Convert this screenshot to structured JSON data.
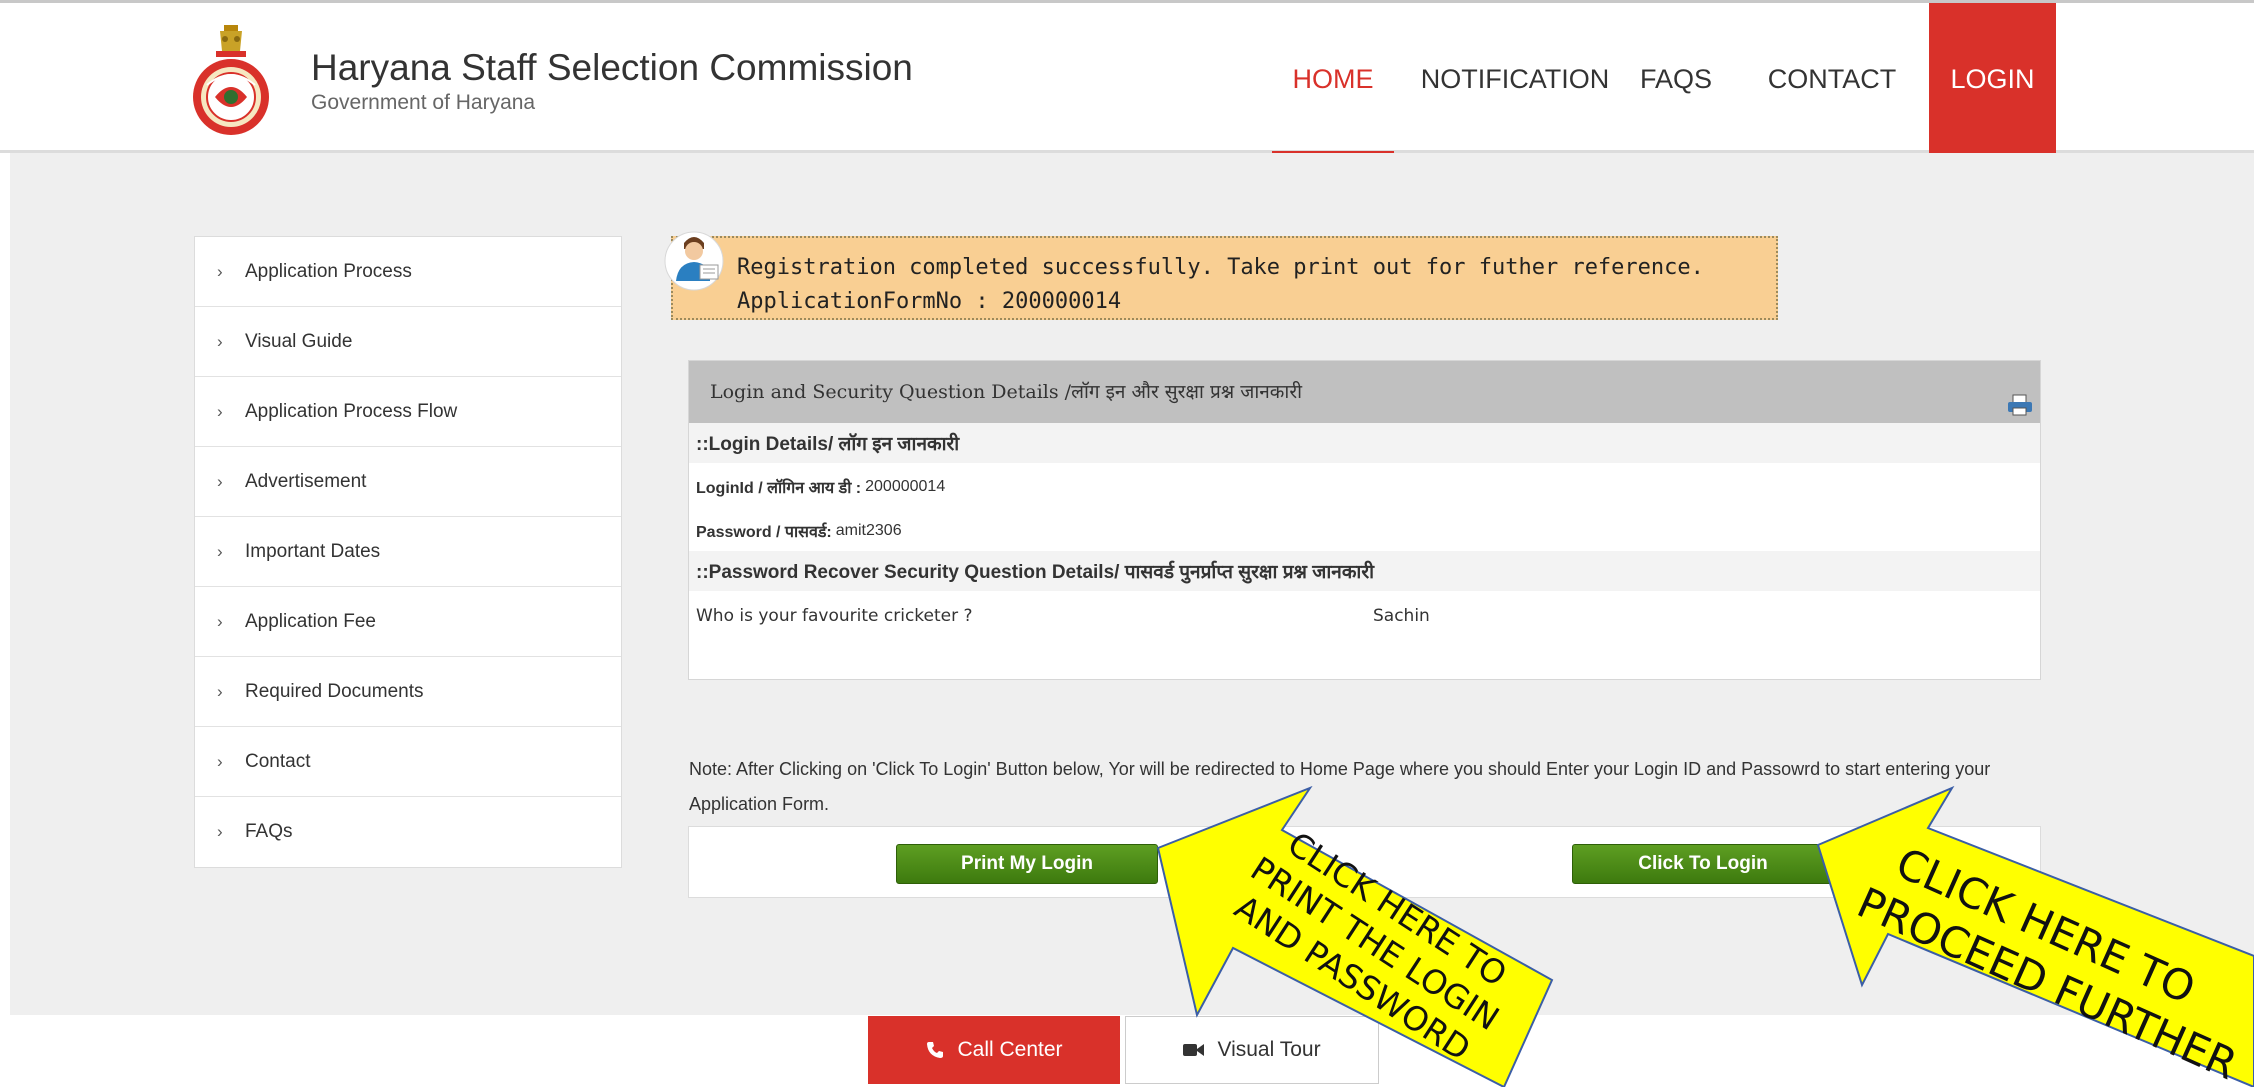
{
  "header": {
    "title": "Haryana Staff Selection Commission",
    "subtitle": "Government of Haryana",
    "nav": [
      "HOME",
      "NOTIFICATION",
      "FAQS",
      "CONTACT",
      "LOGIN"
    ],
    "active_nav": "HOME"
  },
  "sidebar": {
    "items": [
      "Application Process",
      "Visual Guide",
      "Application Process Flow",
      "Advertisement",
      "Important Dates",
      "Application Fee",
      "Required Documents",
      "Contact",
      "FAQs"
    ]
  },
  "banner": {
    "line1": "Registration completed successfully. Take print out for futher reference.",
    "line2": "ApplicationFormNo : 200000014"
  },
  "panel": {
    "title": "Login and Security Question Details /लॉग इन और सुरक्षा प्रश्न जानकारी",
    "login_section": "::Login Details/ लॉग इन जानकारी",
    "login_label": "LoginId / लॉगिन आय डी :",
    "login_value": "200000014",
    "password_label": "Password / पासवर्ड:",
    "password_value": "amit2306",
    "security_section": "::Password Recover Security Question Details/ पासवर्ड पुनर्प्राप्त सुरक्षा प्रश्न जानकारी",
    "question": "Who is your favourite cricketer ?",
    "answer": "Sachin"
  },
  "note": "Note: After Clicking on 'Click To Login' Button below, Yor will be redirected to Home Page where you should Enter your Login ID and Passowrd to start entering your Application Form.",
  "buttons": {
    "print": "Print My Login",
    "login": "Click To Login"
  },
  "bottom": {
    "call_center": "Call Center",
    "visual_tour": "Visual Tour"
  },
  "annotations": {
    "arrow1": [
      "CLICK HERE TO",
      "PRINT THE LOGIN",
      "AND PASSWORD"
    ],
    "arrow2": [
      "CLICK HERE TO",
      "PROCEED FURTHER"
    ]
  },
  "colors": {
    "brand_red": "#d9312a",
    "banner_bg": "#f9cf93",
    "button_green": "#4a8c16",
    "arrow_yellow": "#ffff00"
  }
}
